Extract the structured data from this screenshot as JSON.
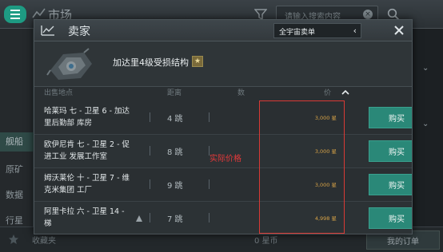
{
  "background": {
    "title": "市场",
    "search_placeholder": "请输入搜索内容",
    "sidebar_items": [
      "舰船",
      "原矿",
      "数据",
      "行星"
    ],
    "footer": {
      "favorites": "收藏夹",
      "amount": "0 星币",
      "my_orders": "我的订单"
    }
  },
  "modal": {
    "title": "卖家",
    "region": "全宇宙卖单",
    "item_name": "加达里4级受损结构",
    "columns": {
      "location": "出售地点",
      "jumps": "距离",
      "quantity": "数",
      "price": "价"
    },
    "buy_label": "购买",
    "orders": [
      {
        "location": "哈莱玛 七 - 卫星 6 - 加达里后勤部 库房",
        "jumps": "4 跳",
        "price": "3,000 星"
      },
      {
        "location": "欧伊尼肯 七 - 卫星 2 - 促进工业 发展工作室",
        "jumps": "8 跳",
        "price": "3,000 星"
      },
      {
        "location": "姆沃莱伦 十 - 卫星 7 - 维克米集团 工厂",
        "jumps": "9 跳",
        "price": "3,000 星"
      },
      {
        "location": "阿里卡拉 六 - 卫星 14 - 梯",
        "jumps": "7 跳",
        "price": "4,998 星"
      }
    ]
  },
  "annotation": {
    "label": "实际价格",
    "color": "#e8393a"
  },
  "colors": {
    "accent": "#2a8878",
    "price": "#d6a246"
  }
}
